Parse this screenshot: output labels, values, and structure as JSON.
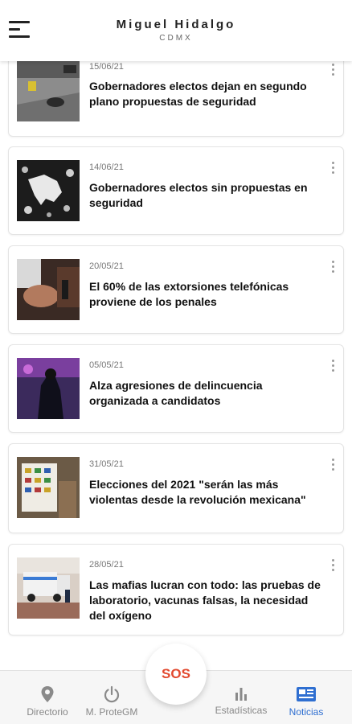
{
  "header": {
    "title": "Miguel Hidalgo",
    "subtitle": "CDMX",
    "menu_icon": "hamburger-menu-icon"
  },
  "news": [
    {
      "date": "15/06/21",
      "title": "Gobernadores electos dejan en segundo plano propuestas de seguridad",
      "image": "crime-scene-street-photo"
    },
    {
      "date": "14/06/21",
      "title": "Gobernadores electos sin propuestas en seguridad",
      "image": "mexico-map-bullet-holes"
    },
    {
      "date": "20/05/21",
      "title": "El 60% de las extorsiones telefónicas proviene de los penales",
      "image": "person-on-phone-photo"
    },
    {
      "date": "05/05/21",
      "title": "Alza agresiones de delincuencia organizada a candidatos",
      "image": "police-officer-night-photo"
    },
    {
      "date": "31/05/21",
      "title": "Elecciones del 2021 \"serán las más violentas desde la revolución mexicana\"",
      "image": "ballot-sheet-photo"
    },
    {
      "date": "28/05/21",
      "title": "Las mafias lucran con todo: las pruebas de laboratorio, vacunas falsas, la necesidad del oxígeno",
      "image": "ambulance-street-photo"
    }
  ],
  "bottom_nav": {
    "sos_label": "SOS",
    "items": [
      {
        "label": "Directorio",
        "icon": "map-pin-icon",
        "active": false
      },
      {
        "label": "M. ProteGM",
        "icon": "power-icon",
        "active": false
      },
      {
        "label": "Estadísticas",
        "icon": "bar-chart-icon",
        "active": false
      },
      {
        "label": "Noticias",
        "icon": "newspaper-icon",
        "active": true
      }
    ]
  },
  "colors": {
    "accent": "#2f6fd1",
    "sos": "#e2492f",
    "inactive": "#888888"
  }
}
